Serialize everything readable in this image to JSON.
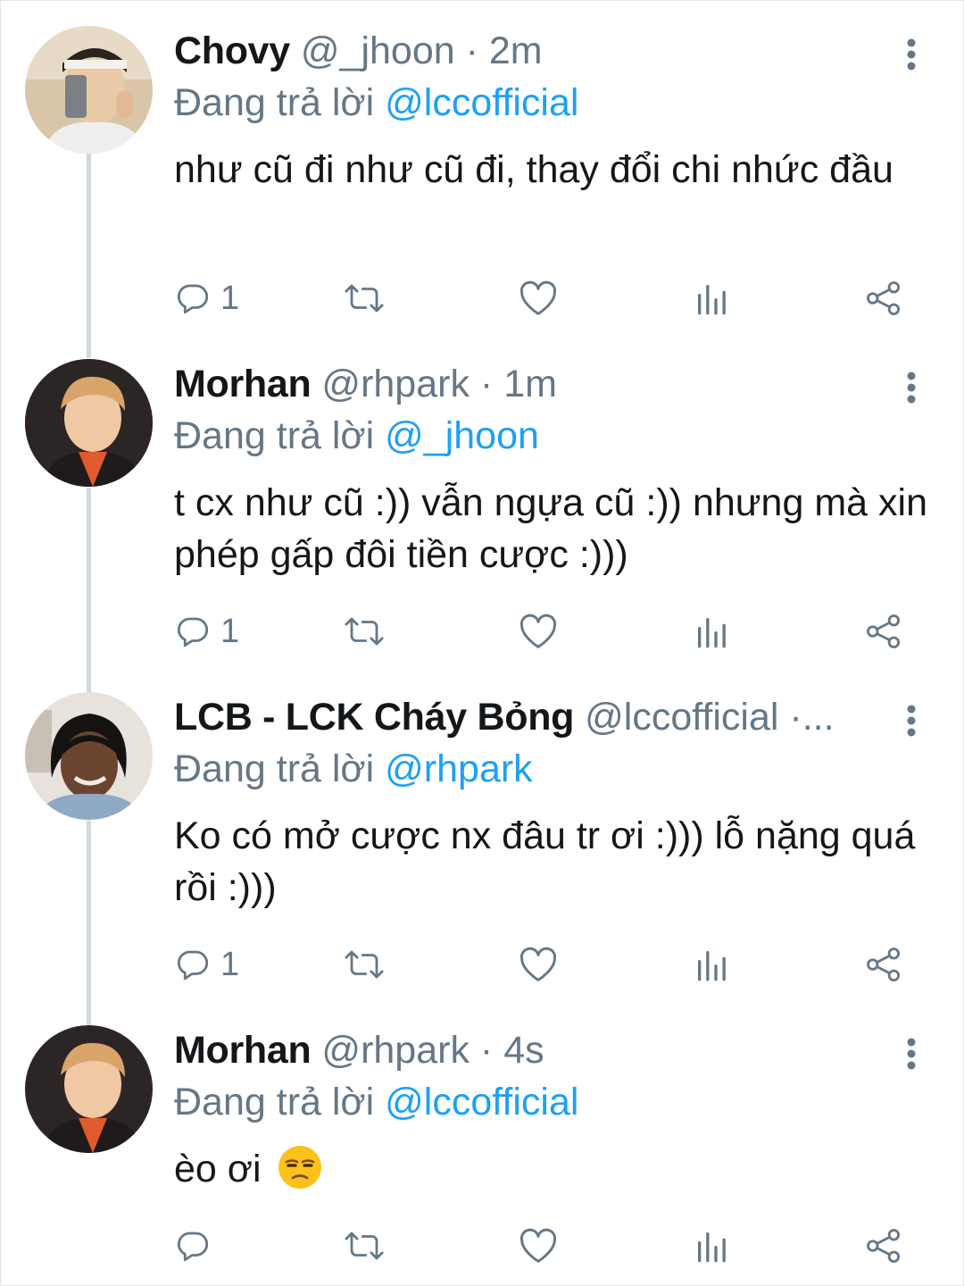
{
  "tweets": [
    {
      "name": "Chovy",
      "handle": "@_jhoon",
      "time": "· 2m",
      "reply_prefix": "Đang trả lời",
      "reply_to": "@lccofficial",
      "text": "như cũ đi như cũ đi, thay đổi chi nhức đầu",
      "reply_count": "1",
      "avatar_bg": "#d9c6a8"
    },
    {
      "name": "Morhan",
      "handle": "@rhpark",
      "time": "· 1m",
      "reply_prefix": "Đang trả lời",
      "reply_to": "@_jhoon",
      "text": "t cx như cũ :)) vẫn ngựa cũ :)) nhưng mà xin phép gấp đôi tiền cược :)))",
      "reply_count": "1",
      "avatar_bg": "#3b3436"
    },
    {
      "name": "LCB - LCK Cháy Bỏng",
      "handle": "@lccofficial",
      "time": "·...",
      "reply_prefix": "Đang trả lời",
      "reply_to": "@rhpark",
      "text": "Ko có mở cược nx đâu tr ơi :))) lỗ nặng quá rồi :)))",
      "reply_count": "1",
      "avatar_bg": "#e8e2dc"
    },
    {
      "name": "Morhan",
      "handle": "@rhpark",
      "time": "· 4s",
      "reply_prefix": "Đang trả lời",
      "reply_to": "@lccofficial",
      "text": "èo ơi",
      "emoji": "unamused-face-emoji",
      "reply_count": "",
      "avatar_bg": "#3b3436"
    }
  ],
  "icons": {
    "reply": "reply-icon",
    "retweet": "retweet-icon",
    "like": "heart-icon",
    "analytics": "analytics-icon",
    "share": "share-icon",
    "more": "more-vertical-icon"
  },
  "colors": {
    "link": "#1da1f2",
    "secondary": "#657786",
    "text": "#14171a",
    "thread_line": "#cfd9de"
  }
}
